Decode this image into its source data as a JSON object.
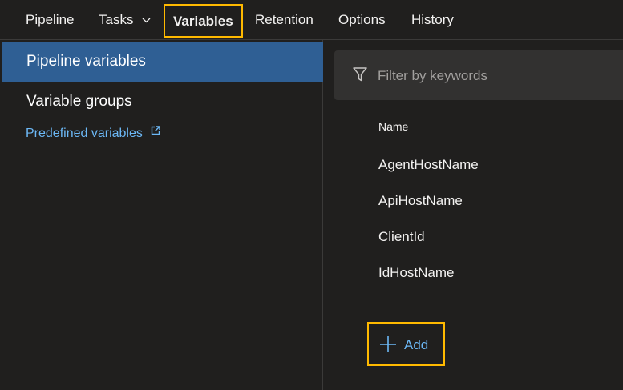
{
  "tabs": [
    {
      "label": "Pipeline"
    },
    {
      "label": "Tasks"
    },
    {
      "label": "Variables"
    },
    {
      "label": "Retention"
    },
    {
      "label": "Options"
    },
    {
      "label": "History"
    }
  ],
  "active_tab": "Variables",
  "sidebar": {
    "items": [
      {
        "label": "Pipeline variables",
        "selected": true
      },
      {
        "label": "Variable groups",
        "selected": false
      }
    ],
    "link": {
      "label": "Predefined variables"
    }
  },
  "filter": {
    "placeholder": "Filter by keywords",
    "value": ""
  },
  "table": {
    "columns": [
      "Name"
    ],
    "rows": [
      {
        "name": "AgentHostName"
      },
      {
        "name": "ApiHostName"
      },
      {
        "name": "ClientId"
      },
      {
        "name": "IdHostName"
      }
    ]
  },
  "add_button": {
    "label": "Add"
  },
  "colors": {
    "background": "#201f1e",
    "selected_nav": "#2f5f94",
    "link": "#6cb8f6",
    "highlight_border": "#ffb900",
    "filter_bg": "#323130"
  },
  "icons": {
    "tasks_chevron": "chevron-down-icon",
    "external_link": "external-link-icon",
    "filter": "filter-icon",
    "add": "plus-icon"
  }
}
